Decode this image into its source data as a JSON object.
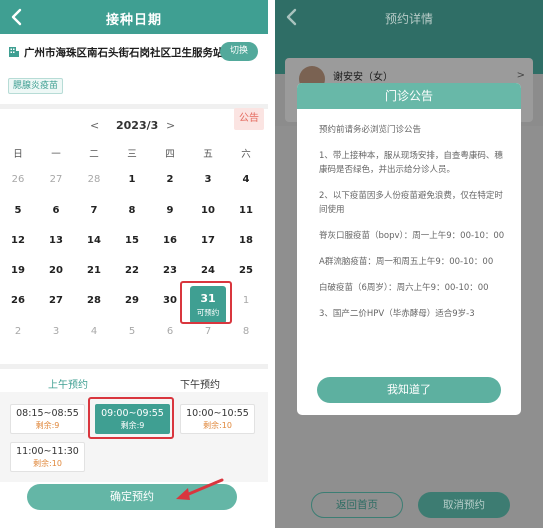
{
  "left": {
    "header": {
      "title": "接种日期"
    },
    "site": {
      "name": "广州市海珠区南石头街石岗社区卫生服务站",
      "switch_label": "切换"
    },
    "vaccine_tag": "腮腺炎疫苗",
    "calendar": {
      "prev": "<",
      "month": "2023/3",
      "next": ">",
      "notice_tab": "公告",
      "weekdays": [
        "日",
        "一",
        "二",
        "三",
        "四",
        "五",
        "六"
      ],
      "weeks": [
        [
          {
            "d": "26",
            "m": true
          },
          {
            "d": "27",
            "m": true
          },
          {
            "d": "28",
            "m": true
          },
          {
            "d": "1"
          },
          {
            "d": "2"
          },
          {
            "d": "3"
          },
          {
            "d": "4"
          }
        ],
        [
          {
            "d": "5"
          },
          {
            "d": "6"
          },
          {
            "d": "7"
          },
          {
            "d": "8"
          },
          {
            "d": "9"
          },
          {
            "d": "10"
          },
          {
            "d": "11"
          }
        ],
        [
          {
            "d": "12"
          },
          {
            "d": "13"
          },
          {
            "d": "14"
          },
          {
            "d": "15"
          },
          {
            "d": "16"
          },
          {
            "d": "17"
          },
          {
            "d": "18"
          }
        ],
        [
          {
            "d": "19"
          },
          {
            "d": "20"
          },
          {
            "d": "21"
          },
          {
            "d": "22"
          },
          {
            "d": "23"
          },
          {
            "d": "24"
          },
          {
            "d": "25"
          }
        ],
        [
          {
            "d": "26"
          },
          {
            "d": "27"
          },
          {
            "d": "28"
          },
          {
            "d": "29"
          },
          {
            "d": "30"
          },
          {
            "d": "31"
          },
          {
            "d": "1",
            "m": true
          }
        ],
        [
          {
            "d": "2",
            "m": true
          },
          {
            "d": "3",
            "m": true
          },
          {
            "d": "4",
            "m": true
          },
          {
            "d": "5",
            "m": true
          },
          {
            "d": "6",
            "m": true
          },
          {
            "d": "7",
            "m": true
          },
          {
            "d": "8",
            "m": true
          }
        ]
      ],
      "selected_day": {
        "day": "31",
        "status": "可预约"
      }
    },
    "period_tabs": {
      "am": "上午预约",
      "pm": "下午预约"
    },
    "slots": [
      {
        "time": "08:15~08:55",
        "remain": "剩余:9"
      },
      {
        "time": "09:00~09:55",
        "remain": "剩余:9",
        "active": true
      },
      {
        "time": "10:00~10:55",
        "remain": "剩余:10"
      },
      {
        "time": "11:00~11:30",
        "remain": "剩余:10"
      }
    ],
    "confirm_label": "确定预约"
  },
  "right": {
    "header": {
      "title": "预约详情"
    },
    "patient": {
      "name": "谢安安（女）",
      "arrow": ">"
    },
    "modal": {
      "title": "门诊公告",
      "paragraphs": [
        "预约前请务必浏览门诊公告",
        "1、带上接种本，服从现场安排，自查粤康码、穗康码是否绿色，并出示给分诊人员。",
        "2、以下疫苗因多人份疫苗避免浪费，仅在特定时间使用",
        "脊灰口服疫苗（bopv）：周一上午9：00-10：00",
        "A群流脑疫苗：周一和周五上午9：00-10：00",
        "白破疫苗（6周岁）：周六上午9：00-10：00",
        "3、国产二价HPV（毕赤酵母）适合9岁-3"
      ],
      "ok_label": "我知道了"
    },
    "bottom": {
      "home_label": "返回首页",
      "cancel_label": "取消预约"
    }
  }
}
